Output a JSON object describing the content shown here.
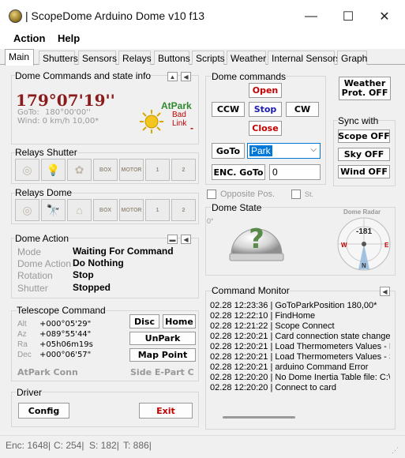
{
  "window": {
    "title": "| ScopeDome Arduino Dome v10 f13",
    "minimize": "—",
    "maximize": "☐",
    "close": "✕"
  },
  "menu": [
    "Action",
    "Help"
  ],
  "tabs": [
    "Main",
    "Shutters",
    "Sensors",
    "Relays",
    "Buttons",
    "Scripts",
    "Weather",
    "Internal Sensors",
    "Graph"
  ],
  "dome_info": {
    "title": "Dome Commands and state info",
    "azimuth": "179°07'19''",
    "goto_label": "GoTo:",
    "goto_value": "180°00'00''",
    "wind": "Wind: 0 km/h 10,00*",
    "atpark": "AtPark",
    "badlink": "Bad\nLink",
    "dash": "-"
  },
  "relays_shutter": {
    "title": "Relays Shutter",
    "icons": [
      "◎",
      "💡",
      "✿",
      "BOX",
      "MOTOR",
      "1",
      "2"
    ]
  },
  "relays_dome": {
    "title": "Relays Dome",
    "icons": [
      "◎",
      "🔭",
      "⌂",
      "BOX",
      "MOTOR",
      "1",
      "2"
    ]
  },
  "dome_action": {
    "title": "Dome Action",
    "rows": [
      {
        "label": "Mode",
        "value": "Waiting For Command"
      },
      {
        "label": "Dome Action",
        "value": "Do Nothing"
      },
      {
        "label": "Rotation",
        "value": "Stop"
      },
      {
        "label": "Shutter",
        "value": "Stopped"
      }
    ]
  },
  "telescope": {
    "title": "Telescope Command",
    "rows": [
      {
        "label": "Alt",
        "value": "+000°05'29\""
      },
      {
        "label": "Az",
        "value": "+089°55'44\""
      },
      {
        "label": "Ra",
        "value": "+05h06m19s"
      },
      {
        "label": "Dec",
        "value": "+000°06'57\""
      }
    ],
    "buttons": {
      "disc": "Disc",
      "home": "Home",
      "unpark": "UnPark",
      "mappoint": "Map Point"
    },
    "status_left": "AtPark Conn",
    "status_right": "Side E-Part C"
  },
  "driver": {
    "title": "Driver",
    "config": "Config",
    "exit": "Exit"
  },
  "dome_commands": {
    "title": "Dome commands",
    "open": "Open",
    "ccw": "CCW",
    "stop": "Stop",
    "cw": "CW",
    "close": "Close",
    "goto": "GoTo",
    "goto_select": "Park",
    "enc_goto": "ENC. GoTo",
    "enc_value": "0",
    "opposite": "Opposite Pos.",
    "st": "St."
  },
  "weather_btn": "Weather\nProt. OFF",
  "sync": {
    "title": "Sync with",
    "scope": "Scope OFF",
    "sky": "Sky OFF",
    "wind": "Wind OFF"
  },
  "dome_state": {
    "title": "Dome State",
    "zero": "0°",
    "radar_title": "Dome Radar",
    "radar_value": "-181",
    "radar_w": "W",
    "radar_e": "E",
    "radar_n": "N"
  },
  "monitor": {
    "title": "Command Monitor",
    "lines": [
      "02.28 12:23:36 | GoToParkPosition 180,00*",
      "02.28 12:22:10 | FindHome",
      "02.28 12:21:22 | Scope Connect",
      "02.28 12:20:21 | Card connection state change",
      "02.28 12:20:21 | Load Thermometers Values - E",
      "02.28 12:20:21 | Load Thermometers Values - S",
      "02.28 12:20:21 | arduino Command Error",
      "02.28 12:20:20 | No Dome Inertia Table file:  C:\\",
      "02.28 12:20:20 | Connect to card"
    ]
  },
  "statusbar": {
    "enc": "Enc: 1648|",
    "c": "C: 254|",
    "s": "S: 182|",
    "t": "T: 886|"
  },
  "colors": {
    "azimuth": "#8b1a1a",
    "atpark": "#2f8a2f",
    "badlink": "#c00000",
    "red_button": "#c00000",
    "blue_button": "#1b1bb0"
  }
}
